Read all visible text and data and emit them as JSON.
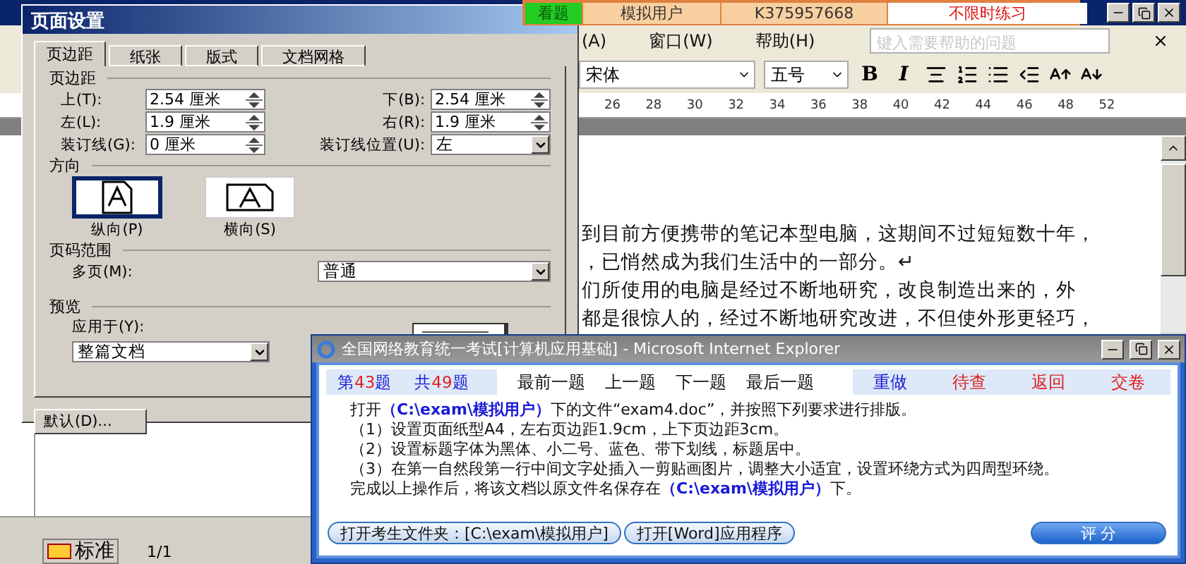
{
  "word": {
    "menu": [
      {
        "label": "(A)"
      },
      {
        "label": "窗口(W)"
      },
      {
        "label": "帮助(H)"
      }
    ],
    "help_placeholder": "键入需要帮助的问题",
    "font": "宋体",
    "size": "五号",
    "bold": "B",
    "italic": "I",
    "ruler": [
      "26",
      "28",
      "30",
      "32",
      "34",
      "36",
      "38",
      "40",
      "42",
      "44",
      "46",
      "48",
      "52"
    ],
    "paragraphs": [
      "到目前方便携带的笔记本型电脑，这期间不过短短数十年，",
      "，已悄然成为我们生活中的一部分。↵",
      "们所使用的电脑是经过不断地研究，改良制造出来的，外",
      "都是很惊人的，经过不断地研究改进，不但使外形更轻巧，"
    ],
    "ime": "标准",
    "page": "1/1"
  },
  "exam_bar": [
    {
      "label": "看题",
      "kind": "action"
    },
    {
      "label": "模拟用户",
      "kind": "info"
    },
    {
      "label": "K375957668",
      "kind": "info"
    },
    {
      "label": "不限时练习",
      "kind": "mode"
    }
  ],
  "page_setup": {
    "title": "页面设置",
    "tabs": [
      {
        "label": "页边距",
        "selected": true
      },
      {
        "label": "纸张",
        "selected": false
      },
      {
        "label": "版式",
        "selected": false
      },
      {
        "label": "文档网格",
        "selected": false
      }
    ],
    "margins_title": "页边距",
    "margins": [
      {
        "label": "上(T):",
        "value": "2.54 厘米"
      },
      {
        "label": "下(B):",
        "value": "2.54 厘米"
      },
      {
        "label": "左(L):",
        "value": "1.9 厘米"
      },
      {
        "label": "右(R):",
        "value": "1.9 厘米"
      },
      {
        "label": "装订线(G):",
        "value": "0 厘米"
      }
    ],
    "gutter_position": {
      "label": "装订线位置(U):",
      "value": "左"
    },
    "orientation_title": "方向",
    "orientations": [
      {
        "label": "纵向(P)",
        "selected": true,
        "kind": "portrait"
      },
      {
        "label": "横向(S)",
        "selected": false,
        "kind": "landscape"
      }
    ],
    "pages_title": "页码范围",
    "pages": {
      "label": "多页(M):",
      "value": "普通"
    },
    "preview_title": "预览",
    "apply": {
      "label": "应用于(Y):",
      "value": "整篇文档"
    },
    "default_button": "默认(D)..."
  },
  "exam_window": {
    "title": "全国网络教育统一考试[计算机应用基础] - Microsoft Internet Explorer",
    "counters": [
      {
        "prefix": "第",
        "number": "43",
        "suffix": "题"
      },
      {
        "prefix": "共",
        "number": "49",
        "suffix": "题"
      }
    ],
    "nav": [
      {
        "label": "最前一题"
      },
      {
        "label": "上一题"
      },
      {
        "label": "下一题"
      },
      {
        "label": "最后一题"
      }
    ],
    "actions": [
      {
        "label": "重做",
        "color": "#1a1ad8"
      },
      {
        "label": "待查",
        "color": "#e02020"
      },
      {
        "label": "返回",
        "color": "#e02020"
      },
      {
        "label": "交卷",
        "color": "#e02020"
      }
    ],
    "lines": [
      "打开**（C:\\exam\\模拟用户）**下的文件“exam4.doc”，并按照下列要求进行排版。",
      "（1）设置页面纸型A4，左右页边距1.9cm，上下页边距3cm。",
      "（2）设置标题字体为黑体、小二号、蓝色、带下划线，标题居中。",
      "（3）在第一自然段第一行中间文字处插入一剪贴画图片，调整大小适宜，设置环绕方式为四周型环绕。",
      "完成以上操作后，将该文档以原文件名保存在**（C:\\exam\\模拟用户）**下。"
    ],
    "buttons": [
      {
        "label": "打开考生文件夹：[C:\\exam\\模拟用户]",
        "kind": "pill"
      },
      {
        "label": "打开[Word]应用程序",
        "kind": "pill"
      },
      {
        "label": "评 分",
        "kind": "score"
      }
    ]
  }
}
